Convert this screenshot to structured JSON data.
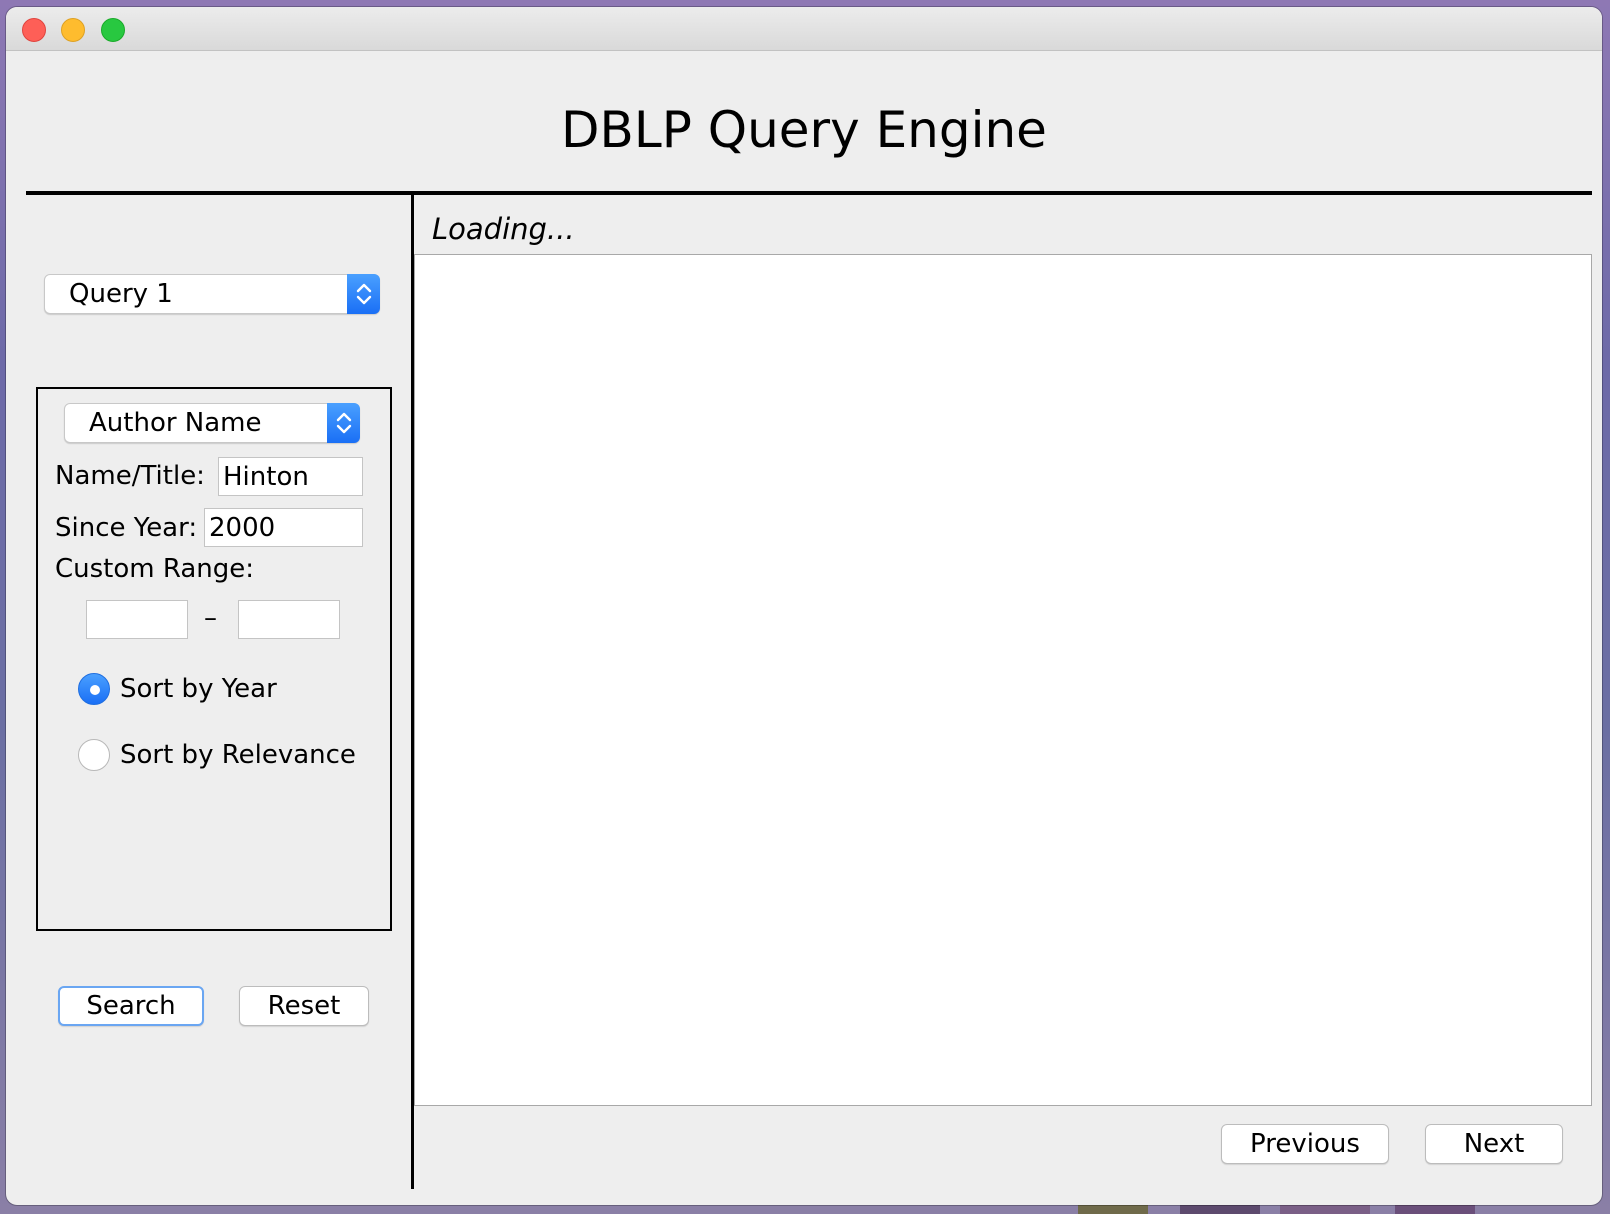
{
  "window": {
    "title": "DBLP Query Engine"
  },
  "query_selector": {
    "selected": "Query 1"
  },
  "filter": {
    "search_type": "Author Name",
    "name_title_label": "Name/Title:",
    "name_title_value": "Hinton",
    "since_year_label": "Since Year:",
    "since_year_value": "2000",
    "custom_range_label": "Custom Range:",
    "range_from_value": "",
    "range_to_value": "",
    "range_separator": "–",
    "sort_by_year_label": "Sort by Year",
    "sort_by_relevance_label": "Sort by Relevance",
    "sort_selected": "year"
  },
  "actions": {
    "search_label": "Search",
    "reset_label": "Reset"
  },
  "results": {
    "status": "Loading...",
    "previous_label": "Previous",
    "next_label": "Next"
  },
  "colors": {
    "accent": "#1a6ff5",
    "window_bg": "#eeeeee",
    "close": "#fe5f57",
    "minimize": "#febc2e",
    "maximize": "#28c840"
  }
}
